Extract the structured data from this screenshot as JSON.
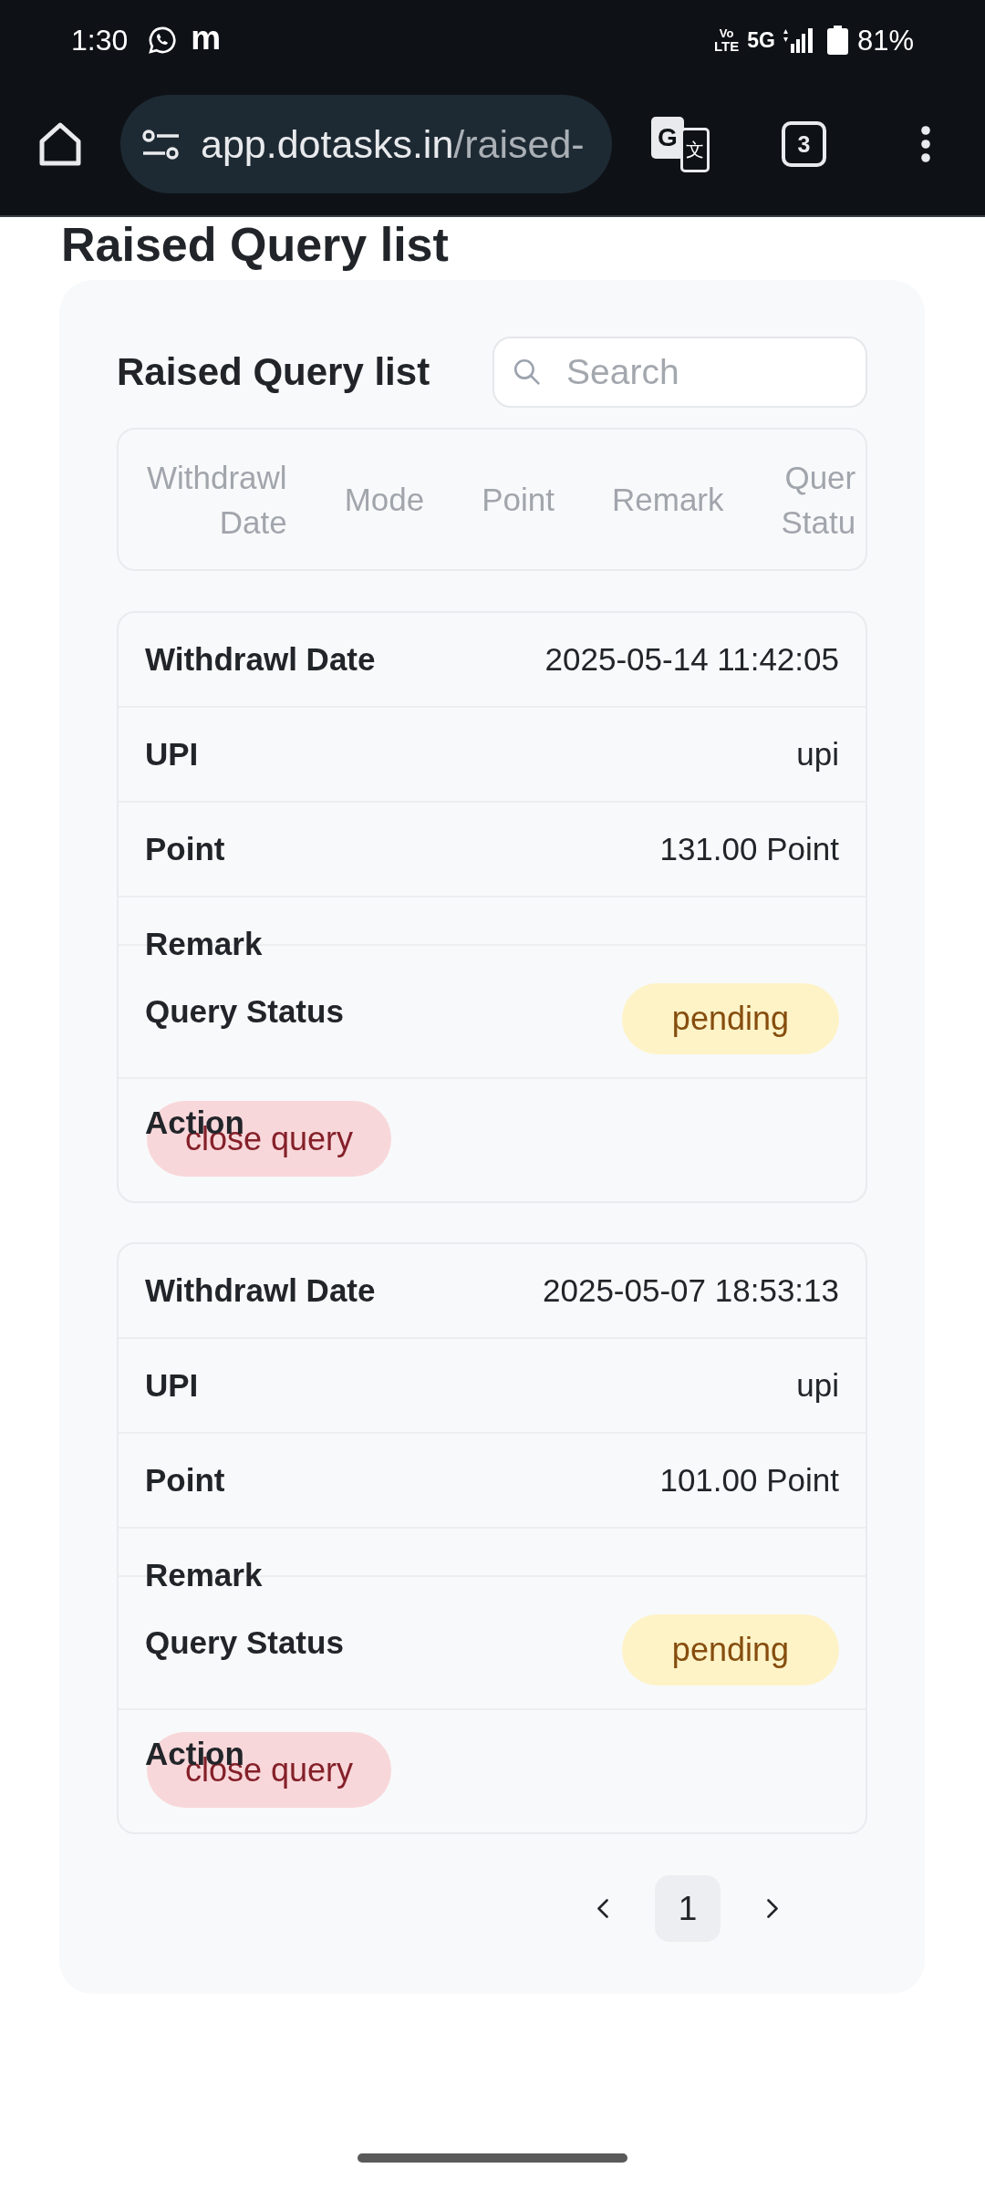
{
  "status_bar": {
    "time": "1:30",
    "app_glyph": "m",
    "volte": [
      "Vo",
      "LTE"
    ],
    "network": "5G",
    "battery": "81%"
  },
  "browser": {
    "url_host": "app.dotasks.in",
    "url_path": "/raised-",
    "translate_glyphs": [
      "G",
      "文"
    ],
    "tab_count": "3"
  },
  "page": {
    "heading": "Raised Query list"
  },
  "panel": {
    "title": "Raised Query list",
    "search": {
      "placeholder": "Search"
    },
    "columns": [
      "Withdrawl Date",
      "Mode",
      "Point",
      "Remark",
      "Quer Statu"
    ]
  },
  "records": [
    {
      "fields": [
        {
          "kind": "text",
          "label": "Withdrawl Date",
          "value": "2025-05-14 11:42:05"
        },
        {
          "kind": "text",
          "label": "UPI",
          "value": "upi"
        },
        {
          "kind": "text",
          "label": "Point",
          "value": "131.00 Point"
        },
        {
          "kind": "blank",
          "label": "Remark"
        },
        {
          "kind": "badge",
          "label": "Query Status",
          "value": "pending"
        },
        {
          "kind": "button",
          "label": "Action",
          "button": "close query"
        }
      ]
    },
    {
      "fields": [
        {
          "kind": "text",
          "label": "Withdrawl Date",
          "value": "2025-05-07 18:53:13"
        },
        {
          "kind": "text",
          "label": "UPI",
          "value": "upi"
        },
        {
          "kind": "text",
          "label": "Point",
          "value": "101.00 Point"
        },
        {
          "kind": "blank",
          "label": "Remark"
        },
        {
          "kind": "badge",
          "label": "Query Status",
          "value": "pending"
        },
        {
          "kind": "button",
          "label": "Action",
          "button": "close query"
        }
      ]
    }
  ],
  "pagination": {
    "pages": [
      {
        "label": "1",
        "selected": true
      }
    ]
  }
}
